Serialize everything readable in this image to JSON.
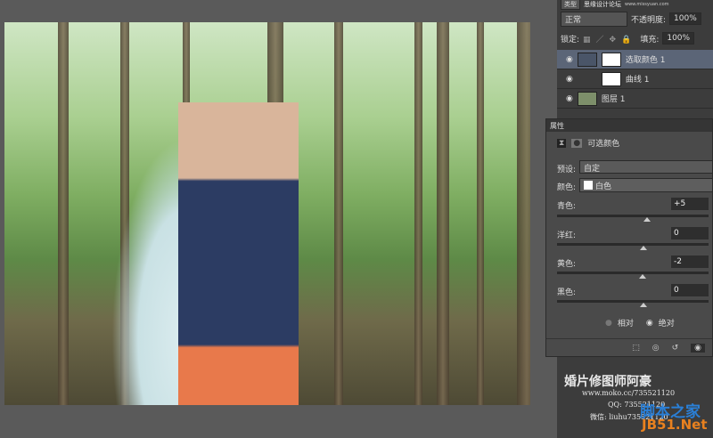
{
  "top_watermark": {
    "site": "思缘设计论坛",
    "url": "www.missyuan.com"
  },
  "layers_panel": {
    "kind_label": "类型",
    "blend_mode": "正常",
    "opacity_label": "不透明度:",
    "opacity_value": "100%",
    "lock_label": "锁定:",
    "fill_label": "填充:",
    "fill_value": "100%",
    "layers": [
      {
        "name": "选取颜色 1",
        "selected": true
      },
      {
        "name": "曲线 1",
        "selected": false
      },
      {
        "name": "图层 1",
        "selected": false
      }
    ]
  },
  "properties": {
    "tab": "属性",
    "title": "可选颜色",
    "preset_label": "预设:",
    "preset_value": "自定",
    "colors_label": "颜色:",
    "colors_value": "白色",
    "sliders": [
      {
        "label": "青色:",
        "value": "+5",
        "percent": 5
      },
      {
        "label": "洋红:",
        "value": "0",
        "percent": 0
      },
      {
        "label": "黄色:",
        "value": "-2",
        "percent": -2
      },
      {
        "label": "黑色:",
        "value": "0",
        "percent": 0
      }
    ],
    "method_relative": "相对",
    "method_absolute": "绝对",
    "selected_method": "absolute"
  },
  "credits": {
    "name": "婚片修图师阿豪",
    "url": "www.moko.cc/735521120",
    "qq": "QQ: 735521120",
    "wechat": "微信: liuhu735521120"
  },
  "site_logo": {
    "top": "脚本之家",
    "bottom": "JB51.Net"
  }
}
